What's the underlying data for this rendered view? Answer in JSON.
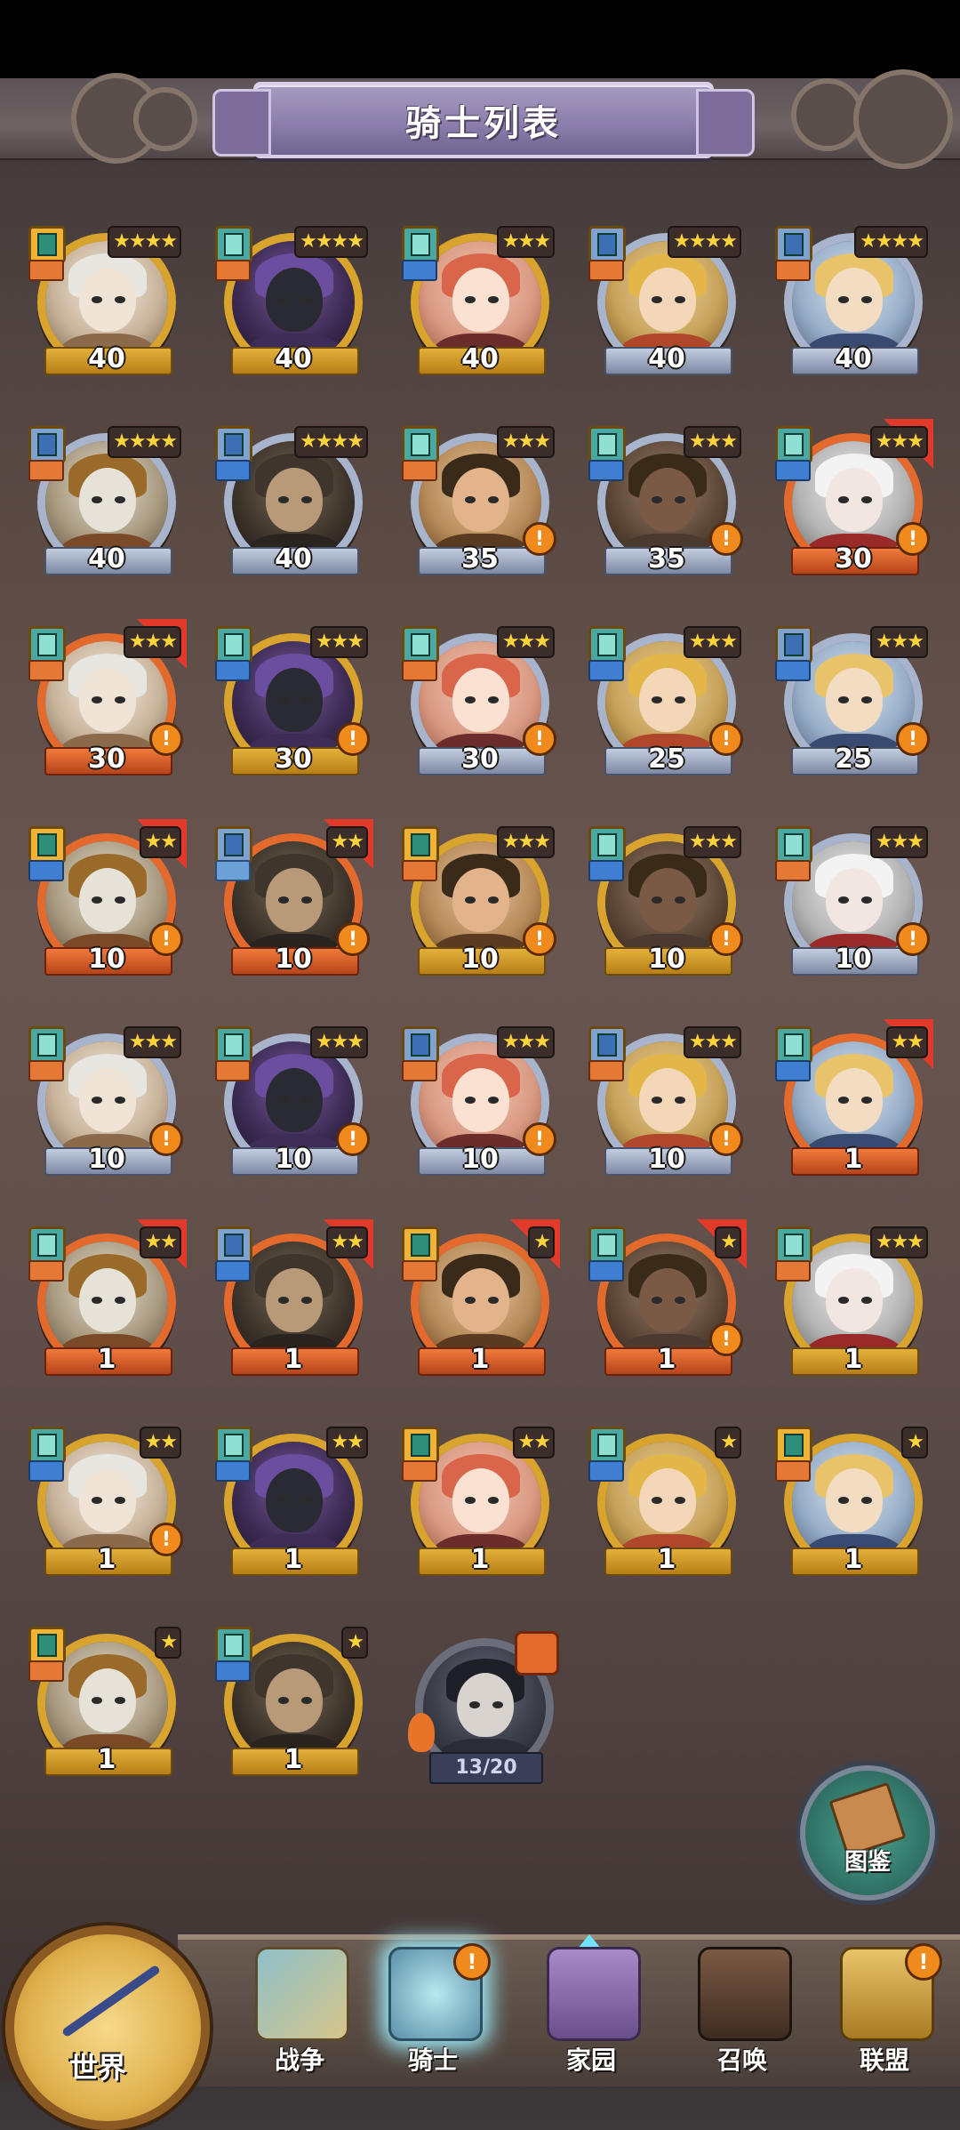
{
  "header": {
    "title": "骑士列表"
  },
  "colors": {
    "gold": "#d9a42d",
    "silver": "#a8b4cc",
    "orange": "#e36a2c",
    "star": "#ffd33a",
    "alert": "#f08a1c"
  },
  "knights": [
    {
      "level": "40",
      "stars": "★★★★",
      "frame": "gold",
      "cls": "gold",
      "role": "orange",
      "alert": false,
      "flag": false
    },
    {
      "level": "40",
      "stars": "★★★★",
      "frame": "gold",
      "cls": "teal",
      "role": "orange",
      "alert": false,
      "flag": false
    },
    {
      "level": "40",
      "stars": "★★★",
      "frame": "gold",
      "cls": "teal",
      "role": "blue",
      "alert": false,
      "flag": false
    },
    {
      "level": "40",
      "stars": "★★★★",
      "frame": "silver",
      "cls": "blue",
      "role": "orange",
      "alert": false,
      "flag": false
    },
    {
      "level": "40",
      "stars": "★★★★",
      "frame": "silver",
      "cls": "blue",
      "role": "orange",
      "alert": false,
      "flag": false
    },
    {
      "level": "40",
      "stars": "★★★★",
      "frame": "silver",
      "cls": "blue",
      "role": "orange",
      "alert": false,
      "flag": false
    },
    {
      "level": "40",
      "stars": "★★★★",
      "frame": "silver",
      "cls": "blue",
      "role": "blue",
      "alert": false,
      "flag": false
    },
    {
      "level": "35",
      "stars": "★★★",
      "frame": "silver",
      "cls": "teal",
      "role": "orange",
      "alert": true,
      "flag": false
    },
    {
      "level": "35",
      "stars": "★★★",
      "frame": "silver",
      "cls": "teal",
      "role": "blue",
      "alert": true,
      "flag": false
    },
    {
      "level": "30",
      "stars": "★★★",
      "frame": "orange",
      "cls": "teal",
      "role": "blue",
      "alert": true,
      "flag": true
    },
    {
      "level": "30",
      "stars": "★★★",
      "frame": "orange",
      "cls": "teal",
      "role": "orange",
      "alert": true,
      "flag": true
    },
    {
      "level": "30",
      "stars": "★★★",
      "frame": "gold",
      "cls": "teal",
      "role": "blue",
      "alert": true,
      "flag": false
    },
    {
      "level": "30",
      "stars": "★★★",
      "frame": "silver",
      "cls": "teal",
      "role": "orange",
      "alert": true,
      "flag": false
    },
    {
      "level": "25",
      "stars": "★★★",
      "frame": "silver",
      "cls": "teal",
      "role": "blue",
      "alert": true,
      "flag": false
    },
    {
      "level": "25",
      "stars": "★★★",
      "frame": "silver",
      "cls": "blue",
      "role": "blue",
      "alert": true,
      "flag": false
    },
    {
      "level": "10",
      "stars": "★★",
      "frame": "orange",
      "cls": "gold",
      "role": "blue",
      "alert": true,
      "flag": true
    },
    {
      "level": "10",
      "stars": "★★",
      "frame": "orange",
      "cls": "blue",
      "role": "lblue",
      "alert": true,
      "flag": true
    },
    {
      "level": "10",
      "stars": "★★★",
      "frame": "gold",
      "cls": "gold",
      "role": "orange",
      "alert": true,
      "flag": false
    },
    {
      "level": "10",
      "stars": "★★★",
      "frame": "gold",
      "cls": "teal",
      "role": "blue",
      "alert": true,
      "flag": false
    },
    {
      "level": "10",
      "stars": "★★★",
      "frame": "silver",
      "cls": "teal",
      "role": "orange",
      "alert": true,
      "flag": false
    },
    {
      "level": "10",
      "stars": "★★★",
      "frame": "silver",
      "cls": "teal",
      "role": "orange",
      "alert": true,
      "flag": false
    },
    {
      "level": "10",
      "stars": "★★★",
      "frame": "silver",
      "cls": "teal",
      "role": "orange",
      "alert": true,
      "flag": false
    },
    {
      "level": "10",
      "stars": "★★★",
      "frame": "silver",
      "cls": "blue",
      "role": "orange",
      "alert": true,
      "flag": false
    },
    {
      "level": "10",
      "stars": "★★★",
      "frame": "silver",
      "cls": "blue",
      "role": "orange",
      "alert": true,
      "flag": false
    },
    {
      "level": "1",
      "stars": "★★",
      "frame": "orange",
      "cls": "teal",
      "role": "blue",
      "alert": false,
      "flag": true
    },
    {
      "level": "1",
      "stars": "★★",
      "frame": "orange",
      "cls": "teal",
      "role": "orange",
      "alert": false,
      "flag": true
    },
    {
      "level": "1",
      "stars": "★★",
      "frame": "orange",
      "cls": "blue",
      "role": "blue",
      "alert": false,
      "flag": true
    },
    {
      "level": "1",
      "stars": "★",
      "frame": "orange",
      "cls": "gold",
      "role": "orange",
      "alert": false,
      "flag": true
    },
    {
      "level": "1",
      "stars": "★",
      "frame": "orange",
      "cls": "teal",
      "role": "blue",
      "alert": true,
      "flag": true
    },
    {
      "level": "1",
      "stars": "★★★",
      "frame": "gold",
      "cls": "teal",
      "role": "orange",
      "alert": false,
      "flag": false
    },
    {
      "level": "1",
      "stars": "★★",
      "frame": "gold",
      "cls": "teal",
      "role": "blue",
      "alert": true,
      "flag": false
    },
    {
      "level": "1",
      "stars": "★★",
      "frame": "gold",
      "cls": "teal",
      "role": "blue",
      "alert": false,
      "flag": false
    },
    {
      "level": "1",
      "stars": "★★",
      "frame": "gold",
      "cls": "gold",
      "role": "orange",
      "alert": false,
      "flag": false
    },
    {
      "level": "1",
      "stars": "★",
      "frame": "gold",
      "cls": "teal",
      "role": "blue",
      "alert": false,
      "flag": false
    },
    {
      "level": "1",
      "stars": "★",
      "frame": "gold",
      "cls": "gold",
      "role": "orange",
      "alert": false,
      "flag": false
    },
    {
      "level": "1",
      "stars": "★",
      "frame": "gold",
      "cls": "gold",
      "role": "orange",
      "alert": false,
      "flag": false
    },
    {
      "level": "1",
      "stars": "★",
      "frame": "gold",
      "cls": "teal",
      "role": "blue",
      "alert": false,
      "flag": false
    }
  ],
  "fragment": {
    "count": "13/20"
  },
  "codex": {
    "label": "图鉴"
  },
  "nav": {
    "world": "世界",
    "war": "战争",
    "knight": "骑士",
    "home": "家园",
    "summon": "召唤",
    "alliance": "联盟"
  }
}
